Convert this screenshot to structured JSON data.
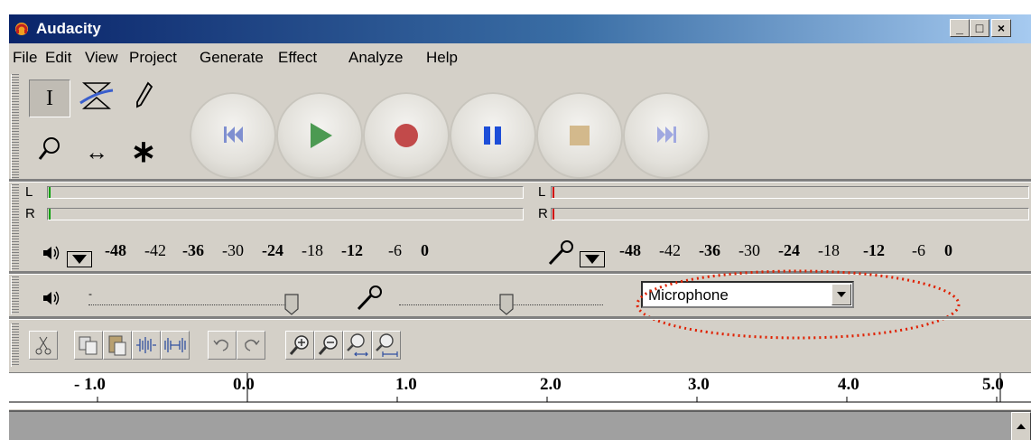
{
  "window": {
    "title": "Audacity",
    "controls": [
      "_",
      "□",
      "×"
    ]
  },
  "menu": [
    "File",
    "Edit",
    "View",
    "Project",
    "Generate",
    "Effect",
    "Analyze",
    "Help"
  ],
  "tools": [
    {
      "name": "selection-tool",
      "icon": "I-beam-icon"
    },
    {
      "name": "envelope-tool",
      "icon": "envelope-icon"
    },
    {
      "name": "draw-tool",
      "icon": "pencil-icon"
    },
    {
      "name": "zoom-tool",
      "icon": "magnifier-icon"
    },
    {
      "name": "time-shift-tool",
      "icon": "arrows-icon"
    },
    {
      "name": "multi-tool",
      "icon": "asterisk-icon"
    }
  ],
  "transport": {
    "colors": {
      "skip": "#7f8fd0",
      "play": "#4c9a52",
      "record": "#c24a4a",
      "pause": "#1d4ed8",
      "stop": "#d3b98c",
      "end": "#a0a8e0"
    }
  },
  "meters": {
    "channel_L": "L",
    "channel_R": "R",
    "scale_labels": [
      "-48",
      "-42",
      "-36",
      "-30",
      "-24",
      "-18",
      "-12",
      "-6",
      "0"
    ]
  },
  "mixer": {
    "input_source": "Microphone"
  },
  "ruler": {
    "labels": [
      "- 1.0",
      "0.0",
      "1.0",
      "2.0",
      "3.0",
      "4.0",
      "5.0"
    ]
  },
  "annotation": {
    "color": "#e02000"
  }
}
